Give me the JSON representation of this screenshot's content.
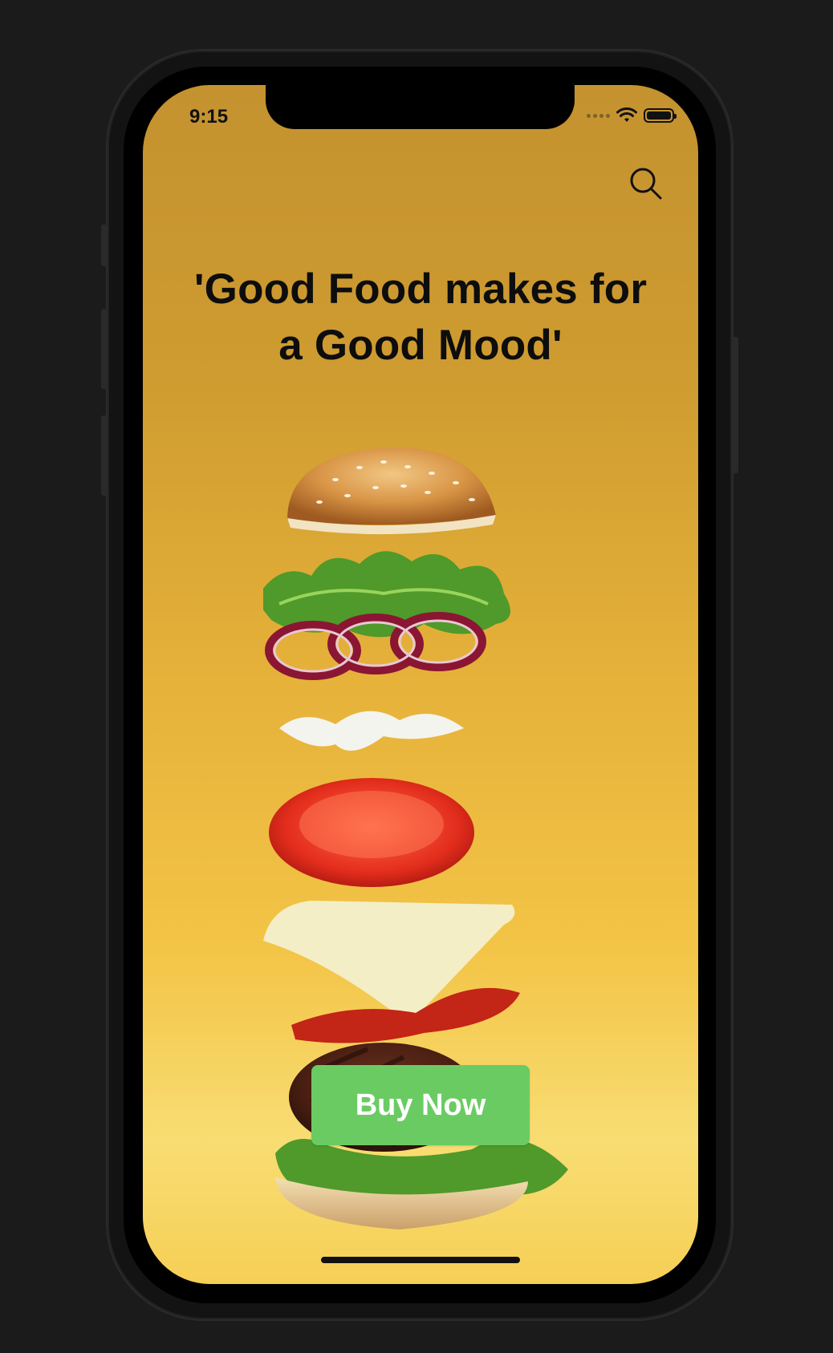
{
  "status_bar": {
    "time": "9:15",
    "icons": [
      "cellular-signal-icon",
      "wifi-icon",
      "battery-icon"
    ],
    "battery_level": 1.0
  },
  "header": {
    "search_icon": "search-icon"
  },
  "hero": {
    "headline": "'Good Food makes for\na Good Mood'",
    "image": "burger-ingredients-illustration"
  },
  "cta": {
    "buy_label": "Buy Now",
    "color": "#6bcb63"
  },
  "colors": {
    "background_top": "#c4922f",
    "background_bottom": "#f8dd73",
    "text": "#0d0d0d",
    "frame": "#131313"
  }
}
